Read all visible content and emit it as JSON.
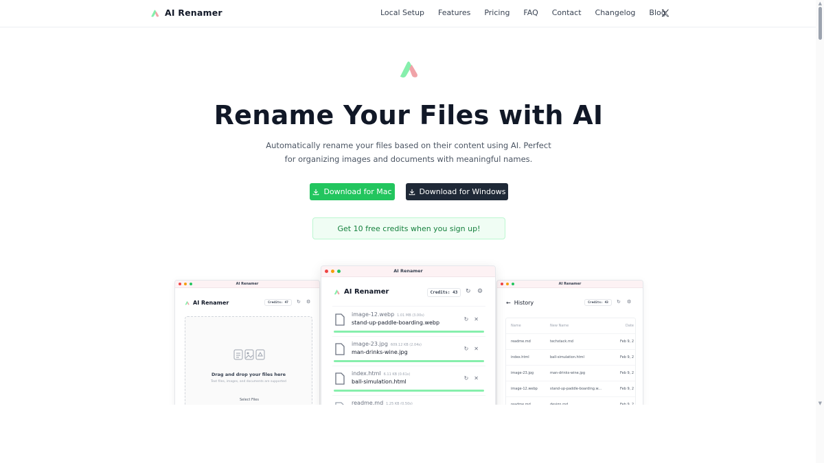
{
  "header": {
    "brand": "AI Renamer",
    "nav": [
      "Local Setup",
      "Features",
      "Pricing",
      "FAQ",
      "Contact",
      "Changelog",
      "Blog"
    ]
  },
  "hero": {
    "title": "Rename Your Files with AI",
    "subtitle_line1": "Automatically rename your files based on their content using AI. Perfect",
    "subtitle_line2": "for organizing images and documents with meaningful names.",
    "download_mac": "Download for Mac",
    "download_windows": "Download for Windows",
    "credits_banner": "Get 10 free credits when you sign up!"
  },
  "colors": {
    "accent_green": "#22c55e",
    "dark_button": "#1f2937",
    "logo_green": "#86efac",
    "logo_red": "#f0a3a8"
  },
  "left_window": {
    "title": "AI Renamer",
    "brand": "AI Renamer",
    "credits": "Credits: 47",
    "drop_title": "Drag and drop your files here",
    "drop_sub": "Text files, images, and documents are supported",
    "select_files": "Select Files"
  },
  "center_window": {
    "title": "AI Renamer",
    "brand": "AI Renamer",
    "credits": "Credits: 43",
    "files": [
      {
        "original": "image-12.webp",
        "meta": "1.01 MB (3.00s)",
        "renamed": "stand-up-paddle-boarding.webp"
      },
      {
        "original": "image-23.jpg",
        "meta": "609.12 KB (2.04s)",
        "renamed": "man-drinks-wine.jpg"
      },
      {
        "original": "index.html",
        "meta": "6.11 KB (0.61s)",
        "renamed": "ball-simulation.html"
      },
      {
        "original": "readme.md",
        "meta": "1.25 KB (0.50s)",
        "renamed": ""
      }
    ]
  },
  "right_window": {
    "title": "AI Renamer",
    "heading": "History",
    "credits": "Credits: 43",
    "columns": [
      "Name",
      "New Name",
      "Date"
    ],
    "rows": [
      [
        "readme.md",
        "techstack.md",
        "Feb 9, 2"
      ],
      [
        "index.html",
        "ball-simulation.html",
        "Feb 9, 2"
      ],
      [
        "image-23.jpg",
        "man-drinks-wine.jpg",
        "Feb 9, 2"
      ],
      [
        "image-12.webp",
        "stand-up-paddle-boarding.w...",
        "Feb 9, 2"
      ],
      [
        "readme.md",
        "design.md",
        "Feb 9, 2"
      ]
    ]
  }
}
